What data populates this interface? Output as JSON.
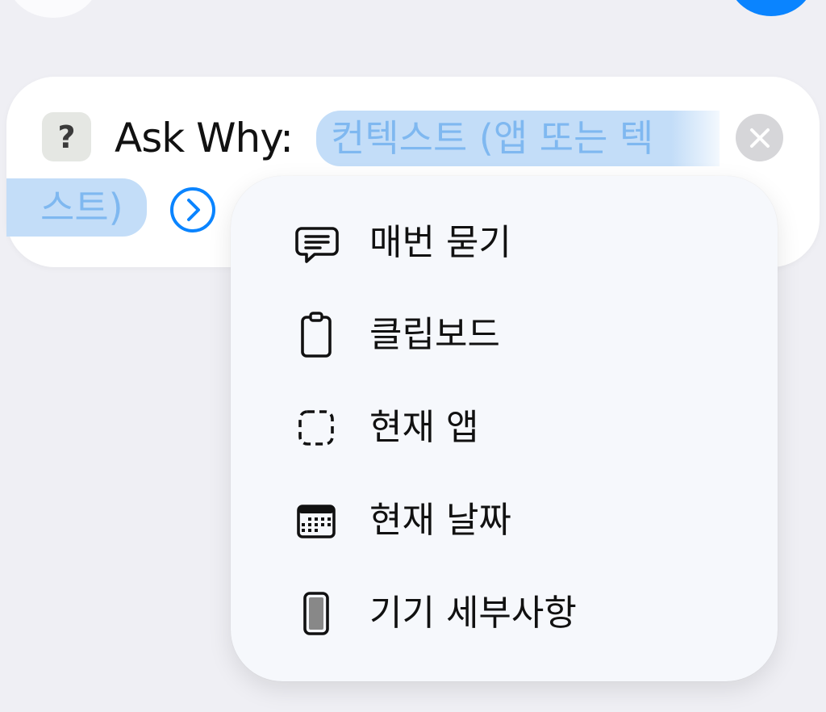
{
  "action": {
    "icon_glyph": "?",
    "title": "Ask Why:",
    "token_line1": "컨텍스트 (앱 또는 텍",
    "token_line2": "스트)",
    "accent_color": "#0a84ff",
    "token_bg_color": "#c3ddf8"
  },
  "menu": {
    "items": [
      {
        "label": "매번 묻기",
        "icon": "speech-bubble-icon"
      },
      {
        "label": "클립보드",
        "icon": "clipboard-icon"
      },
      {
        "label": "현재 앱",
        "icon": "dashed-square-icon"
      },
      {
        "label": "현재 날짜",
        "icon": "calendar-icon"
      },
      {
        "label": "기기 세부사항",
        "icon": "iphone-icon"
      }
    ]
  }
}
